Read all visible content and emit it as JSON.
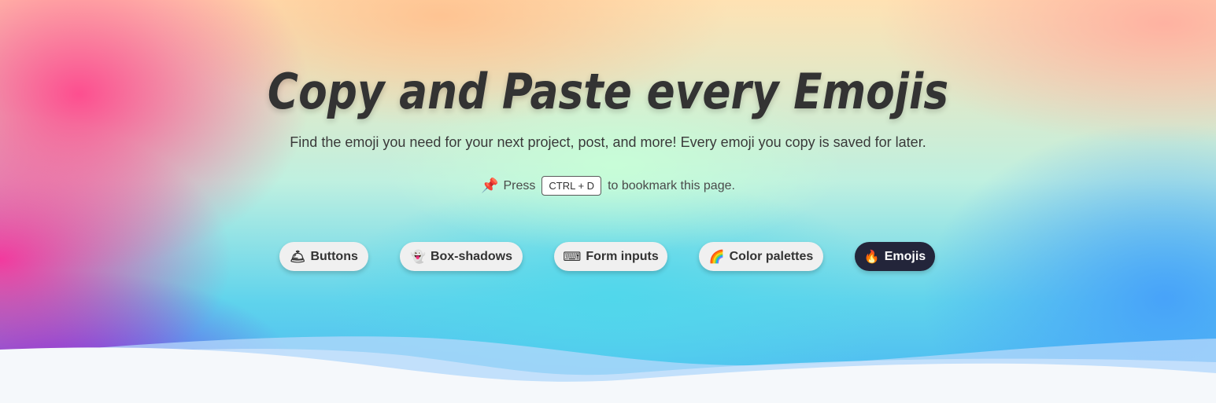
{
  "hero": {
    "title": "Copy and Paste every Emojis",
    "subtitle": "Find the emoji you need for your next project, post, and more! Every emoji you copy is saved for later.",
    "bookmark": {
      "prefix": "Press",
      "shortcut": "CTRL + D",
      "suffix": "to bookmark this page.",
      "icon": "pushpin-icon"
    }
  },
  "nav": [
    {
      "label": "Buttons",
      "icon": "bell-icon",
      "glyph": "🛎"
    },
    {
      "label": "Box-shadows",
      "icon": "ghost-icon",
      "glyph": "👻"
    },
    {
      "label": "Form inputs",
      "icon": "keyboard-icon",
      "glyph": "⌨"
    },
    {
      "label": "Color palettes",
      "icon": "rainbow-icon",
      "glyph": "🌈"
    },
    {
      "label": "Emojis",
      "icon": "fire-icon",
      "glyph": "🔥",
      "active": true
    }
  ],
  "colors": {
    "title": "#333333",
    "active_pill": "#23253a",
    "pill": "#f0f0f0"
  }
}
